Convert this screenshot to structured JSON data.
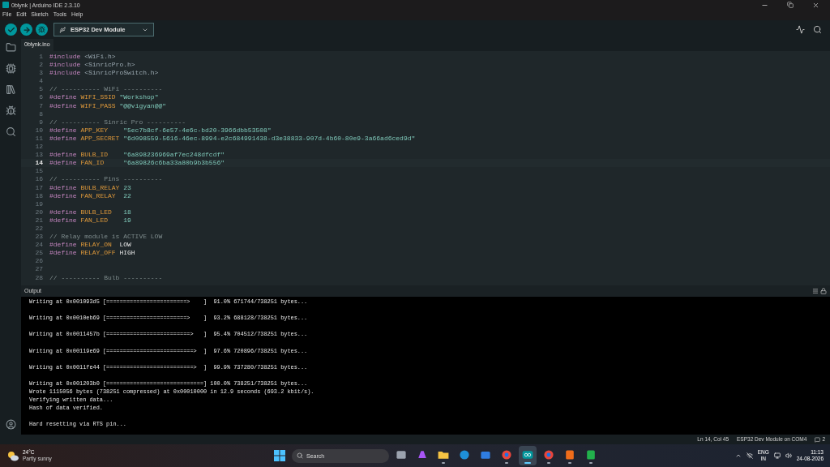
{
  "window": {
    "title": "0blynk | Arduino IDE 2.3.10"
  },
  "menu": [
    "File",
    "Edit",
    "Sketch",
    "Tools",
    "Help"
  ],
  "toolbar": {
    "board": "ESP32 Dev Module"
  },
  "tabs": [
    {
      "label": "0blynk.ino",
      "selected": true
    }
  ],
  "editor": {
    "lines": [
      {
        "number": "1",
        "current": false,
        "tokens": [
          {
            "kind": "directive",
            "text": "#include"
          },
          {
            "kind": "header",
            "text": " <WiFi.h>"
          }
        ]
      },
      {
        "number": "2",
        "current": false,
        "tokens": [
          {
            "kind": "directive",
            "text": "#include"
          },
          {
            "kind": "header",
            "text": " <SinricPro.h>"
          }
        ]
      },
      {
        "number": "3",
        "current": false,
        "tokens": [
          {
            "kind": "directive",
            "text": "#include"
          },
          {
            "kind": "header",
            "text": " <SinricProSwitch.h>"
          }
        ]
      },
      {
        "number": "4",
        "current": false
      },
      {
        "number": "5",
        "current": false,
        "tokens": [
          {
            "kind": "comment",
            "text": "// ---------- WiFi ----------"
          }
        ]
      },
      {
        "number": "6",
        "current": false,
        "tokens": [
          {
            "kind": "directive",
            "text": "#define"
          },
          {
            "kind": "macro",
            "text": " WIFI_SSID"
          },
          {
            "kind": "string",
            "text": " \"Workshop\""
          }
        ]
      },
      {
        "number": "7",
        "current": false,
        "tokens": [
          {
            "kind": "directive",
            "text": "#define"
          },
          {
            "kind": "macro",
            "text": " WIFI_PASS"
          },
          {
            "kind": "string",
            "text": " \"@@vigyan@@\""
          }
        ]
      },
      {
        "number": "8",
        "current": false
      },
      {
        "number": "9",
        "current": false,
        "tokens": [
          {
            "kind": "comment",
            "text": "// ---------- Sinric Pro ----------"
          }
        ]
      },
      {
        "number": "10",
        "current": false,
        "tokens": [
          {
            "kind": "directive",
            "text": "#define"
          },
          {
            "kind": "macro",
            "text": " APP_KEY"
          },
          {
            "kind": "string",
            "text": "    \"5ec7b8cf-6e57-4e6c-bd20-3966dbb53508\""
          }
        ]
      },
      {
        "number": "11",
        "current": false,
        "tokens": [
          {
            "kind": "directive",
            "text": "#define"
          },
          {
            "kind": "macro",
            "text": " APP_SECRET"
          },
          {
            "kind": "string",
            "text": " \"6d098559-5616-46ec-8994-e2c684991438-d3e38833-907d-4b60-80e9-3a66ad6ced9d\""
          }
        ]
      },
      {
        "number": "12",
        "current": false
      },
      {
        "number": "13",
        "current": false,
        "tokens": [
          {
            "kind": "directive",
            "text": "#define"
          },
          {
            "kind": "macro",
            "text": " BULB_ID"
          },
          {
            "kind": "string",
            "text": "    \"6a898236969af7ec248dfcdf\""
          }
        ]
      },
      {
        "number": "14",
        "current": true,
        "tokens": [
          {
            "kind": "directive",
            "text": "#define"
          },
          {
            "kind": "macro",
            "text": " FAN_ID"
          },
          {
            "kind": "string",
            "text": "     \"6a89826c6ba33a80b9b3b556\""
          }
        ]
      },
      {
        "number": "15",
        "current": false
      },
      {
        "number": "16",
        "current": false,
        "tokens": [
          {
            "kind": "comment",
            "text": "// ---------- Pins ----------"
          }
        ]
      },
      {
        "number": "17",
        "current": false,
        "tokens": [
          {
            "kind": "directive",
            "text": "#define"
          },
          {
            "kind": "macro",
            "text": " BULB_RELAY"
          },
          {
            "kind": "number",
            "text": " 23"
          }
        ]
      },
      {
        "number": "18",
        "current": false,
        "tokens": [
          {
            "kind": "directive",
            "text": "#define"
          },
          {
            "kind": "macro",
            "text": " FAN_RELAY"
          },
          {
            "kind": "number",
            "text": "  22"
          }
        ]
      },
      {
        "number": "19",
        "current": false
      },
      {
        "number": "20",
        "current": false,
        "tokens": [
          {
            "kind": "directive",
            "text": "#define"
          },
          {
            "kind": "macro",
            "text": " BULB_LED"
          },
          {
            "kind": "number",
            "text": "   18"
          }
        ]
      },
      {
        "number": "21",
        "current": false,
        "tokens": [
          {
            "kind": "directive",
            "text": "#define"
          },
          {
            "kind": "macro",
            "text": " FAN_LED"
          },
          {
            "kind": "number",
            "text": "    19"
          }
        ]
      },
      {
        "number": "22",
        "current": false
      },
      {
        "number": "23",
        "current": false,
        "tokens": [
          {
            "kind": "comment",
            "text": "// Relay module is ACTIVE LOW"
          }
        ]
      },
      {
        "number": "24",
        "current": false,
        "tokens": [
          {
            "kind": "directive",
            "text": "#define"
          },
          {
            "kind": "macro",
            "text": " RELAY_ON"
          },
          {
            "kind": "constant",
            "text": "  LOW"
          }
        ]
      },
      {
        "number": "25",
        "current": false,
        "tokens": [
          {
            "kind": "directive",
            "text": "#define"
          },
          {
            "kind": "macro",
            "text": " RELAY_OFF"
          },
          {
            "kind": "constant",
            "text": " HIGH"
          }
        ]
      },
      {
        "number": "26",
        "current": false
      },
      {
        "number": "27",
        "current": false
      },
      {
        "number": "28",
        "current": false,
        "tokens": [
          {
            "kind": "comment",
            "text": "// ---------- Bulb ----------"
          }
        ]
      }
    ]
  },
  "output": {
    "title": "Output",
    "lines": [
      "Writing at 0x001093d5 [========================>    ]  91.0% 671744/738251 bytes...",
      "Writing at 0x0010eb69 [========================>    ]  93.2% 688128/738251 bytes...",
      "Writing at 0x0011457b [=========================>   ]  95.4% 704512/738251 bytes...",
      "Writing at 0x00119e69 [==========================>  ]  97.6% 720896/738251 bytes...",
      "Writing at 0x0011fe44 [==========================>  ]  99.9% 737280/738251 bytes...",
      "Writing at 0x001203b0 [=============================] 100.0% 738251/738251 bytes...",
      "Wrote 1115056 bytes (738251 compressed) at 0x00010000 in 12.9 seconds (693.2 kbit/s).",
      "Verifying written data...",
      "Hash of data verified.",
      "Hard resetting via RTS pin..."
    ]
  },
  "status_bar": {
    "position": "Ln 14, Col 45",
    "board": "ESP32 Dev Module on COM4",
    "notifications": "2"
  },
  "taskbar": {
    "weather": {
      "temperature": "24°C",
      "condition": "Partly sunny"
    },
    "search": {
      "placeholder": "Search"
    },
    "apps": [
      {
        "kind": "files",
        "color": "#9ca3af",
        "running": false,
        "selected": false
      },
      {
        "kind": "copilot",
        "color": "#a855f7",
        "running": false,
        "selected": false
      },
      {
        "kind": "folder",
        "color": "#f6c343",
        "running": true,
        "selected": false
      },
      {
        "kind": "browser",
        "color": "#1e90d8",
        "running": false,
        "selected": false
      },
      {
        "kind": "store",
        "color": "#2f7de1",
        "running": false,
        "selected": false
      },
      {
        "kind": "chrome",
        "color": "#e8453c",
        "running": true,
        "selected": false
      },
      {
        "kind": "arduino",
        "color": "#00979d",
        "running": true,
        "selected": true
      },
      {
        "kind": "chrome",
        "color": "#e8453c",
        "running": true,
        "selected": false
      },
      {
        "kind": "app",
        "color": "#ef6c1a",
        "running": true,
        "selected": false
      },
      {
        "kind": "app",
        "color": "#22b14c",
        "running": true,
        "selected": false
      }
    ],
    "language": "ENG",
    "region": "IN",
    "time": "11:13",
    "date": "24-08-2026"
  }
}
